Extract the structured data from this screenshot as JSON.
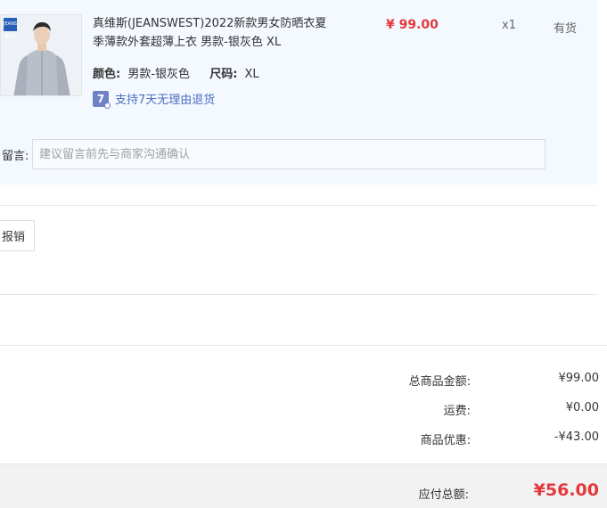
{
  "product": {
    "brand_badge": "JEANS WEST",
    "title_line1": "真维斯(JEANSWEST)2022新款男女防晒衣夏",
    "title_line2": "季薄款外套超薄上衣 男款-银灰色 XL",
    "price": "¥ 99.00",
    "quantity": "x1",
    "stock": "有货",
    "color_label": "颜色:",
    "color_value": "男款-银灰色",
    "size_label": "尺码:",
    "size_value": "XL",
    "support_icon_text": "7",
    "support_text": "支持7天无理由退货"
  },
  "message": {
    "label": "留言:",
    "placeholder": "建议留言前先与商家沟通确认"
  },
  "reimburse_button": "报销",
  "summary": {
    "goods_total_label": "总商品金额:",
    "goods_total_value": "¥99.00",
    "shipping_label": "运费:",
    "shipping_value": "¥0.00",
    "discount_label": "商品优惠:",
    "discount_value": "-¥43.00",
    "payable_label": "应付总额:",
    "payable_value": "¥56.00"
  },
  "colors": {
    "accent_red": "#e4393c",
    "link_blue": "#4d6fc3",
    "panel_bg": "#f3f9ff"
  }
}
